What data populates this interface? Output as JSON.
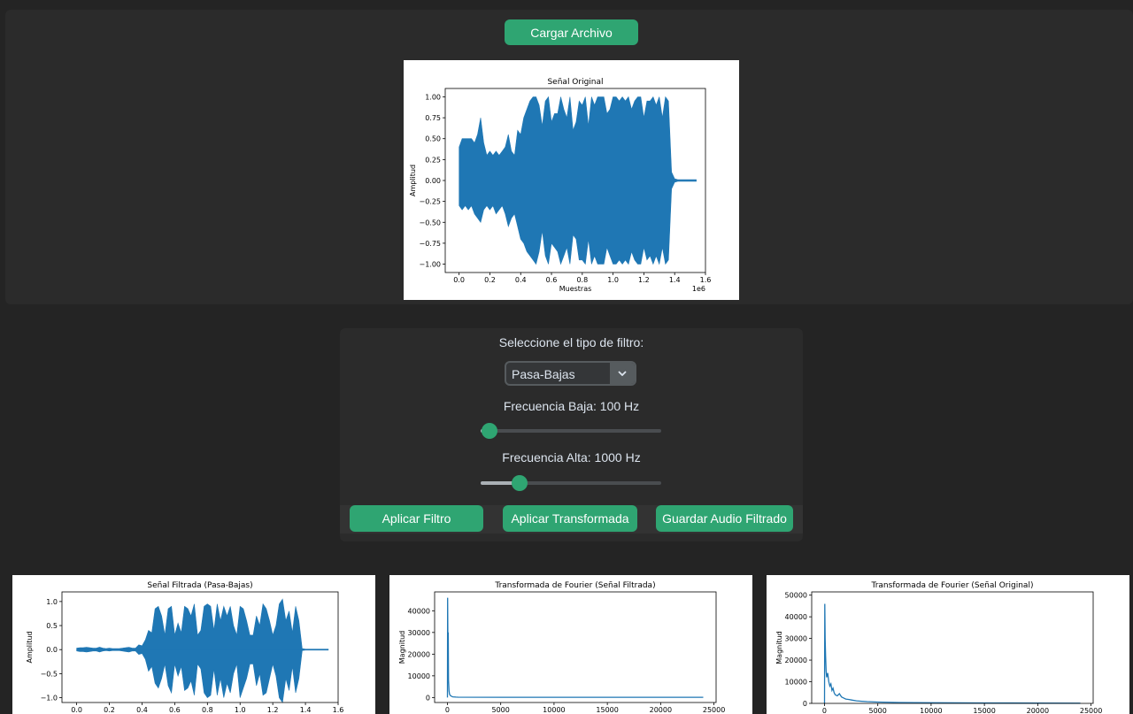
{
  "load_button": "Cargar Archivo",
  "filter": {
    "prompt": "Seleccione el tipo de filtro:",
    "selected": "Pasa-Bajas",
    "low_label": "Frecuencia Baja: 100 Hz",
    "low_fraction": 0.02,
    "high_label": "Frecuencia Alta: 1000 Hz",
    "high_fraction": 0.2
  },
  "buttons": {
    "apply_filter": "Aplicar Filtro",
    "apply_transform": "Aplicar Transformada",
    "save_audio": "Guardar Audio Filtrado"
  },
  "colors": {
    "accent": "#2fa572",
    "series": "#1f77b4"
  },
  "chart_data": [
    {
      "id": "original",
      "type": "line",
      "title": "Señal Original",
      "xlabel": "Muestras",
      "ylabel": "Amplitud",
      "x_offset_label": "1e6",
      "xticks": [
        "0.0",
        "0.2",
        "0.4",
        "0.6",
        "0.8",
        "1.0",
        "1.2",
        "1.4",
        "1.6"
      ],
      "yticks": [
        "1.00",
        "0.75",
        "0.50",
        "0.25",
        "0.00",
        "−0.25",
        "−0.50",
        "−0.75",
        "−1.00"
      ],
      "xlim": [
        -0.09,
        1.6
      ],
      "ylim": [
        -1.1,
        1.1
      ],
      "series": [
        {
          "x": [
            0.0,
            0.02,
            0.04,
            0.06,
            0.08,
            0.1,
            0.12,
            0.14,
            0.16,
            0.18,
            0.2,
            0.22,
            0.24,
            0.26,
            0.28,
            0.3,
            0.32,
            0.34,
            0.36,
            0.38,
            0.4,
            0.42,
            0.44,
            0.46,
            0.48,
            0.5,
            0.52,
            0.54,
            0.56,
            0.58,
            0.6,
            0.62,
            0.64,
            0.66,
            0.68,
            0.7,
            0.72,
            0.74,
            0.76,
            0.78,
            0.8,
            0.82,
            0.84,
            0.86,
            0.88,
            0.9,
            0.92,
            0.94,
            0.96,
            0.98,
            1.0,
            1.02,
            1.04,
            1.06,
            1.08,
            1.1,
            1.12,
            1.14,
            1.16,
            1.18,
            1.2,
            1.22,
            1.24,
            1.26,
            1.28,
            1.3,
            1.32,
            1.34,
            1.36,
            1.38,
            1.4,
            1.42,
            1.44,
            1.46,
            1.48,
            1.5,
            1.52,
            1.54
          ],
          "upper": [
            0.4,
            0.5,
            0.5,
            0.5,
            0.5,
            0.45,
            0.55,
            0.75,
            0.45,
            0.3,
            0.35,
            0.3,
            0.35,
            0.3,
            0.35,
            0.4,
            0.55,
            0.35,
            0.3,
            0.6,
            0.55,
            0.75,
            0.85,
            0.95,
            1.0,
            1.0,
            0.9,
            0.65,
            0.95,
            1.0,
            0.7,
            0.8,
            0.8,
            1.0,
            0.85,
            0.75,
            1.0,
            0.6,
            0.7,
            0.95,
            0.9,
            1.0,
            0.65,
            1.0,
            0.9,
            1.0,
            1.0,
            1.0,
            0.8,
            0.85,
            1.0,
            1.0,
            0.95,
            1.0,
            0.95,
            1.0,
            0.85,
            0.95,
            1.0,
            1.0,
            0.75,
            0.95,
            0.95,
            1.0,
            0.9,
            1.0,
            0.75,
            1.0,
            0.95,
            0.1,
            0.02,
            0.01,
            0.01,
            0.01,
            0.01,
            0.01,
            0.01,
            0.01
          ],
          "lower": [
            -0.3,
            -0.35,
            -0.3,
            -0.35,
            -0.3,
            -0.4,
            -0.45,
            -0.5,
            -0.35,
            -0.3,
            -0.35,
            -0.3,
            -0.4,
            -0.35,
            -0.3,
            -0.4,
            -0.55,
            -0.45,
            -0.4,
            -0.55,
            -0.7,
            -0.75,
            -0.85,
            -0.9,
            -0.95,
            -1.0,
            -0.85,
            -0.6,
            -0.9,
            -1.0,
            -0.75,
            -0.8,
            -0.85,
            -1.0,
            -0.9,
            -0.8,
            -1.0,
            -0.65,
            -0.7,
            -0.95,
            -0.95,
            -1.0,
            -0.7,
            -1.0,
            -0.9,
            -1.0,
            -1.0,
            -1.0,
            -0.8,
            -0.9,
            -1.0,
            -1.0,
            -0.95,
            -1.0,
            -0.95,
            -1.0,
            -0.85,
            -0.95,
            -1.0,
            -1.0,
            -0.8,
            -0.95,
            -0.9,
            -1.0,
            -0.9,
            -1.0,
            -0.8,
            -1.0,
            -0.95,
            -0.1,
            -0.02,
            -0.01,
            -0.01,
            -0.01,
            -0.01,
            -0.01,
            -0.01,
            -0.01
          ]
        }
      ]
    },
    {
      "id": "filtered",
      "type": "line",
      "title": "Señal Filtrada (Pasa-Bajas)",
      "ylabel": "Amplitud",
      "xticks": [
        "0.0",
        "0.2",
        "0.4",
        "0.6",
        "0.8",
        "1.0",
        "1.2",
        "1.4",
        "1.6"
      ],
      "yticks": [
        "1.0",
        "0.5",
        "0.0",
        "−0.5",
        "−1.0"
      ],
      "xlim": [
        -0.09,
        1.6
      ],
      "ylim": [
        -1.1,
        1.2
      ],
      "series": [
        {
          "x": [
            0.0,
            0.02,
            0.04,
            0.06,
            0.08,
            0.1,
            0.12,
            0.14,
            0.16,
            0.18,
            0.2,
            0.22,
            0.24,
            0.26,
            0.28,
            0.3,
            0.32,
            0.34,
            0.36,
            0.38,
            0.4,
            0.42,
            0.44,
            0.46,
            0.48,
            0.5,
            0.52,
            0.54,
            0.56,
            0.58,
            0.6,
            0.62,
            0.64,
            0.66,
            0.68,
            0.7,
            0.72,
            0.74,
            0.76,
            0.78,
            0.8,
            0.82,
            0.84,
            0.86,
            0.88,
            0.9,
            0.92,
            0.94,
            0.96,
            0.98,
            1.0,
            1.02,
            1.04,
            1.06,
            1.08,
            1.1,
            1.12,
            1.14,
            1.16,
            1.18,
            1.2,
            1.22,
            1.24,
            1.26,
            1.28,
            1.3,
            1.32,
            1.34,
            1.36,
            1.38,
            1.4,
            1.42,
            1.44,
            1.46,
            1.48,
            1.5,
            1.52,
            1.54
          ],
          "upper": [
            0.03,
            0.04,
            0.04,
            0.05,
            0.04,
            0.03,
            0.03,
            0.05,
            0.03,
            0.02,
            0.03,
            0.02,
            0.02,
            0.02,
            0.03,
            0.04,
            0.05,
            0.03,
            0.03,
            0.1,
            0.08,
            0.2,
            0.4,
            0.35,
            0.85,
            0.9,
            0.7,
            0.3,
            0.85,
            0.9,
            0.3,
            0.55,
            0.35,
            0.9,
            0.85,
            0.7,
            0.95,
            0.3,
            0.4,
            0.9,
            0.95,
            0.9,
            0.4,
            0.95,
            0.6,
            0.9,
            0.7,
            0.9,
            0.5,
            0.3,
            0.9,
            0.85,
            0.6,
            0.3,
            0.3,
            0.7,
            0.5,
            0.95,
            0.85,
            0.6,
            0.3,
            0.5,
            0.95,
            1.05,
            0.6,
            0.8,
            0.35,
            0.9,
            0.6,
            0.02,
            0.01,
            0.01,
            0.01,
            0.01,
            0.01,
            0.01,
            0.01,
            0.01
          ],
          "lower": [
            -0.03,
            -0.04,
            -0.04,
            -0.05,
            -0.04,
            -0.03,
            -0.03,
            -0.05,
            -0.03,
            -0.02,
            -0.03,
            -0.02,
            -0.02,
            -0.02,
            -0.03,
            -0.04,
            -0.05,
            -0.03,
            -0.03,
            -0.1,
            -0.08,
            -0.2,
            -0.45,
            -0.35,
            -0.7,
            -0.8,
            -0.6,
            -0.3,
            -0.75,
            -0.9,
            -0.3,
            -0.55,
            -0.35,
            -0.85,
            -0.8,
            -0.65,
            -0.95,
            -0.3,
            -0.4,
            -0.9,
            -1.0,
            -0.95,
            -0.4,
            -0.95,
            -0.6,
            -1.0,
            -0.7,
            -0.9,
            -0.5,
            -0.3,
            -1.0,
            -0.8,
            -0.6,
            -0.3,
            -0.3,
            -0.75,
            -0.5,
            -0.95,
            -0.9,
            -0.6,
            -0.3,
            -0.55,
            -1.0,
            -1.1,
            -0.6,
            -0.85,
            -0.35,
            -0.9,
            -0.6,
            -0.02,
            -0.01,
            -0.01,
            -0.01,
            -0.01,
            -0.01,
            -0.01,
            -0.01,
            -0.01
          ]
        }
      ]
    },
    {
      "id": "fft_filtered",
      "type": "line",
      "title": "Transformada de Fourier (Señal Filtrada)",
      "ylabel": "Magnitud",
      "xticks": [
        "0",
        "5000",
        "10000",
        "15000",
        "20000",
        "25000"
      ],
      "xtick_values": [
        0,
        5000,
        10000,
        15000,
        20000,
        25000
      ],
      "yticks": [
        "40000",
        "30000",
        "20000",
        "10000",
        "0"
      ],
      "ytick_values": [
        40000,
        30000,
        20000,
        10000,
        0
      ],
      "xlim": [
        -1200,
        25200
      ],
      "ylim": [
        -2300,
        48700
      ],
      "series": [
        {
          "x": [
            0,
            20,
            50,
            80,
            100,
            150,
            200,
            300,
            400,
            500,
            800,
            1000,
            5000,
            10000,
            15000,
            20000,
            24000
          ],
          "y": [
            0,
            46000,
            20000,
            30000,
            8000,
            3000,
            1500,
            800,
            500,
            300,
            200,
            150,
            100,
            100,
            100,
            100,
            100
          ]
        }
      ]
    },
    {
      "id": "fft_original",
      "type": "line",
      "title": "Transformada de Fourier (Señal Original)",
      "ylabel": "Magnitud",
      "xticks": [
        "0",
        "5000",
        "10000",
        "15000",
        "20000",
        "25000"
      ],
      "xtick_values": [
        0,
        5000,
        10000,
        15000,
        20000,
        25000
      ],
      "yticks": [
        "50000",
        "40000",
        "30000",
        "20000",
        "10000",
        "0"
      ],
      "ytick_values": [
        50000,
        40000,
        30000,
        20000,
        10000,
        0
      ],
      "xlim": [
        -1200,
        25200
      ],
      "ylim": [
        0,
        51500
      ],
      "series": [
        {
          "x": [
            0,
            30,
            60,
            100,
            150,
            200,
            300,
            400,
            500,
            600,
            700,
            800,
            900,
            1000,
            1200,
            1400,
            1600,
            1800,
            2000,
            2300,
            2600,
            3000,
            3500,
            4000,
            5000,
            7000,
            10000,
            15000,
            20000,
            24000
          ],
          "y": [
            0,
            46000,
            30000,
            22000,
            15000,
            12000,
            14000,
            10000,
            8000,
            9000,
            6000,
            7000,
            5000,
            4000,
            3500,
            4500,
            3000,
            2500,
            2000,
            1800,
            1500,
            1200,
            1000,
            800,
            600,
            400,
            300,
            200,
            150,
            100
          ]
        }
      ]
    }
  ]
}
